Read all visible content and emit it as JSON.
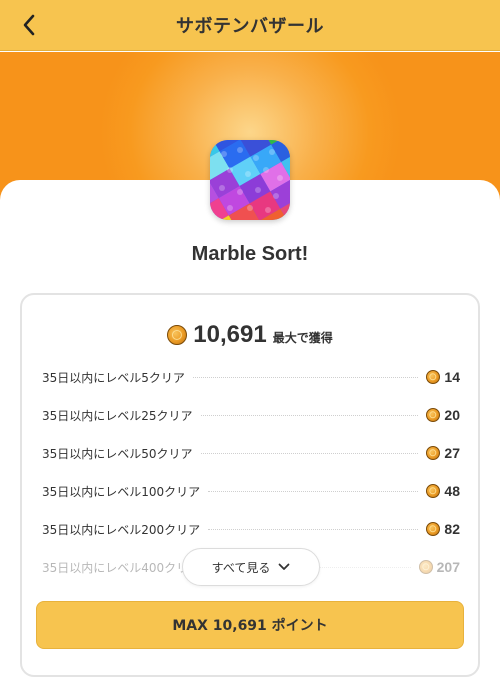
{
  "header": {
    "title": "サボテンバザール",
    "back_icon": "chevron-left-icon"
  },
  "colors": {
    "header_bg": "#f7c44f",
    "hero_orange": "#f7931a",
    "button_bg": "#f7c44f",
    "coin": "#ea9a24"
  },
  "app": {
    "name": "Marble Sort!",
    "icon": "marble-sort-app-icon"
  },
  "rewards": {
    "coin_icon": "coin-icon",
    "total": "10,691",
    "total_suffix": "最大で獲得",
    "tasks": [
      {
        "label": "35日以内にレベル5クリア",
        "points": "14"
      },
      {
        "label": "35日以内にレベル25クリア",
        "points": "20"
      },
      {
        "label": "35日以内にレベル50クリア",
        "points": "27"
      },
      {
        "label": "35日以内にレベル100クリア",
        "points": "48"
      },
      {
        "label": "35日以内にレベル200クリア",
        "points": "82"
      },
      {
        "label": "35日以内にレベル400クリア",
        "points": "207"
      }
    ],
    "see_all_label": "すべて見る",
    "see_all_icon": "chevron-down-icon",
    "max_button_label": "MAX 10,691 ポイント"
  }
}
